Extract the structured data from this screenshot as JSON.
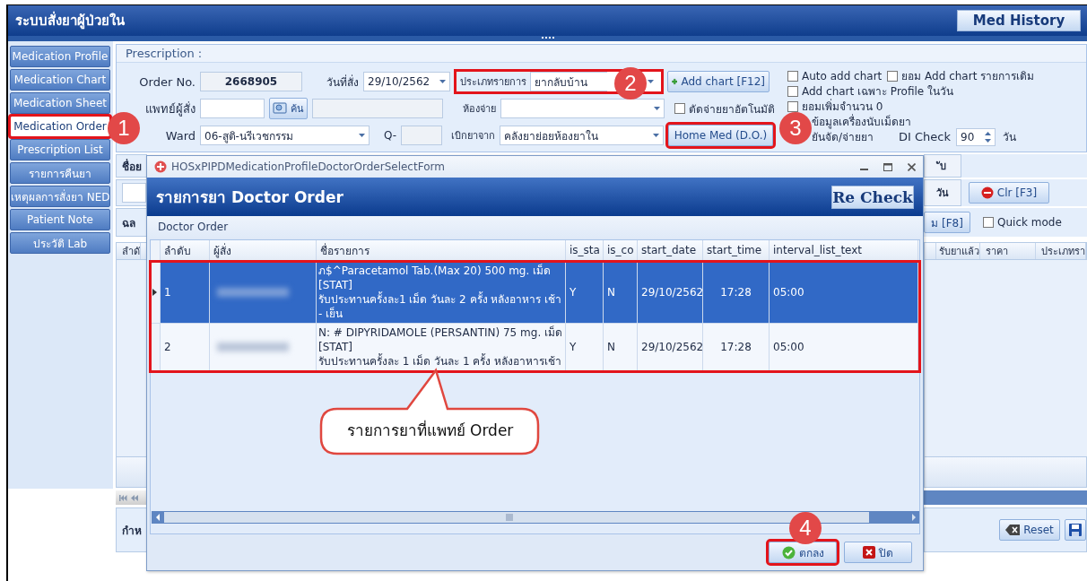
{
  "window": {
    "title": "ระบบสั่งยาผู้ป่วยใน",
    "history_button": "Med History"
  },
  "sidebar": {
    "items": [
      {
        "label": "Medication Profile",
        "selected": false,
        "highlighted": false
      },
      {
        "label": "Medication Chart",
        "selected": false,
        "highlighted": false
      },
      {
        "label": "Medication Sheet",
        "selected": false,
        "highlighted": false
      },
      {
        "label": "Medication Order",
        "selected": true,
        "highlighted": true
      },
      {
        "label": "Prescription List",
        "selected": false,
        "highlighted": false
      },
      {
        "label": "รายการคืนยา",
        "selected": false,
        "highlighted": false
      },
      {
        "label": "เหตุผลการสั่งยา NED",
        "selected": false,
        "highlighted": false
      },
      {
        "label": "Patient Note",
        "selected": false,
        "highlighted": false
      },
      {
        "label": "ประวัติ Lab",
        "selected": false,
        "highlighted": false
      }
    ]
  },
  "prescription": {
    "title": "Prescription :",
    "order_no": {
      "label": "Order No.",
      "value": "2668905"
    },
    "order_date": {
      "label": "วันที่สั่ง",
      "value": "29/10/2562"
    },
    "item_type": {
      "label": "ประเภทรายการ",
      "value": "ยากลับบ้าน",
      "highlighted": true
    },
    "add_chart_button": "Add chart [F12]",
    "doctor": {
      "label": "แพทย์ผู้สั่ง",
      "search_button": "ค้น"
    },
    "dispense_room": {
      "label": "ห้องจ่าย"
    },
    "auto_dispense": {
      "label": "ตัดจ่ายยาอัตโนมัติ",
      "checked": false
    },
    "ward": {
      "label": "Ward",
      "value": "06-สูติ-นรีเวชกรรม"
    },
    "queue": {
      "label": "Q-"
    },
    "draw_from": {
      "label": "เบิกยาจาก",
      "value": "คลังยาย่อยห้องยาใน"
    },
    "home_med_button": {
      "label": "Home Med (D.O.)",
      "highlighted": true
    },
    "options": [
      {
        "label": "Auto add chart",
        "checked": false
      },
      {
        "label": "ยอม Add chart รายการเดิม",
        "checked": false
      },
      {
        "label": "Add chart เฉพาะ Profile ในวัน",
        "checked": false
      },
      {
        "label": "ยอมเพิ่มจำนวน 0",
        "checked": false
      }
    ],
    "covered_options": [
      "ข้อมูลเครื่องนับเม็ดยา",
      "ยันจัด/จ่ายยา"
    ],
    "di_check": {
      "label": "DI Check",
      "value": "90",
      "unit": "วัน"
    }
  },
  "background": {
    "left": {
      "drug_label": "ชื่อย",
      "filter_label": "ฉล",
      "column": "ลำดั",
      "footer_label": "กำห"
    },
    "right": {
      "fragment": "ับ",
      "day_label": "วัน",
      "clear_button": "Clr [F3]",
      "f8_button": "ม [F8]",
      "quick_mode": {
        "label": "Quick mode",
        "checked": false
      },
      "columns": [
        "รับยาแล้ว",
        "ราคา",
        "ประเภทรา"
      ],
      "reset_button": "Reset"
    }
  },
  "dialog": {
    "title": "HOSxPIPDMedicationProfileDoctorOrderSelectForm",
    "heading": "รายการยา Doctor Order",
    "recheck_button": "Re Check",
    "group_label": "Doctor Order",
    "columns": [
      "ลำดับ",
      "ผู้สั่ง",
      "ชื่อรายการ",
      "is_sta",
      "is_co",
      "start_date",
      "start_time",
      "interval_list_text"
    ],
    "rows_highlighted": true,
    "rows": [
      {
        "no": "1",
        "drug": "ภ$^Paracetamol Tab.(Max 20) 500 mg. เม็ด\n[STAT]\nรับประทานครั้งละ1 เม็ด วันละ 2 ครั้ง หลังอาหาร เช้า - เย็น",
        "is_stat": "Y",
        "is_co": "N",
        "start_date": "29/10/2562",
        "start_time": "17:28",
        "interval": "05:00",
        "selected": true
      },
      {
        "no": "2",
        "drug": "N: # DIPYRIDAMOLE (PERSANTIN) 75 mg. เม็ด\n[STAT]\nรับประทานครั้งละ 1 เม็ด วันละ 1 ครั้ง หลังอาหารเช้า",
        "is_stat": "Y",
        "is_co": "N",
        "start_date": "29/10/2562",
        "start_time": "17:28",
        "interval": "05:00",
        "selected": false
      }
    ],
    "ok_button": {
      "label": "ตกลง",
      "highlighted": true
    },
    "close_button": "ปิด"
  },
  "annotations": {
    "markers": [
      "1",
      "2",
      "3",
      "4"
    ],
    "callout": "รายการยาที่แพทย์ Order"
  }
}
